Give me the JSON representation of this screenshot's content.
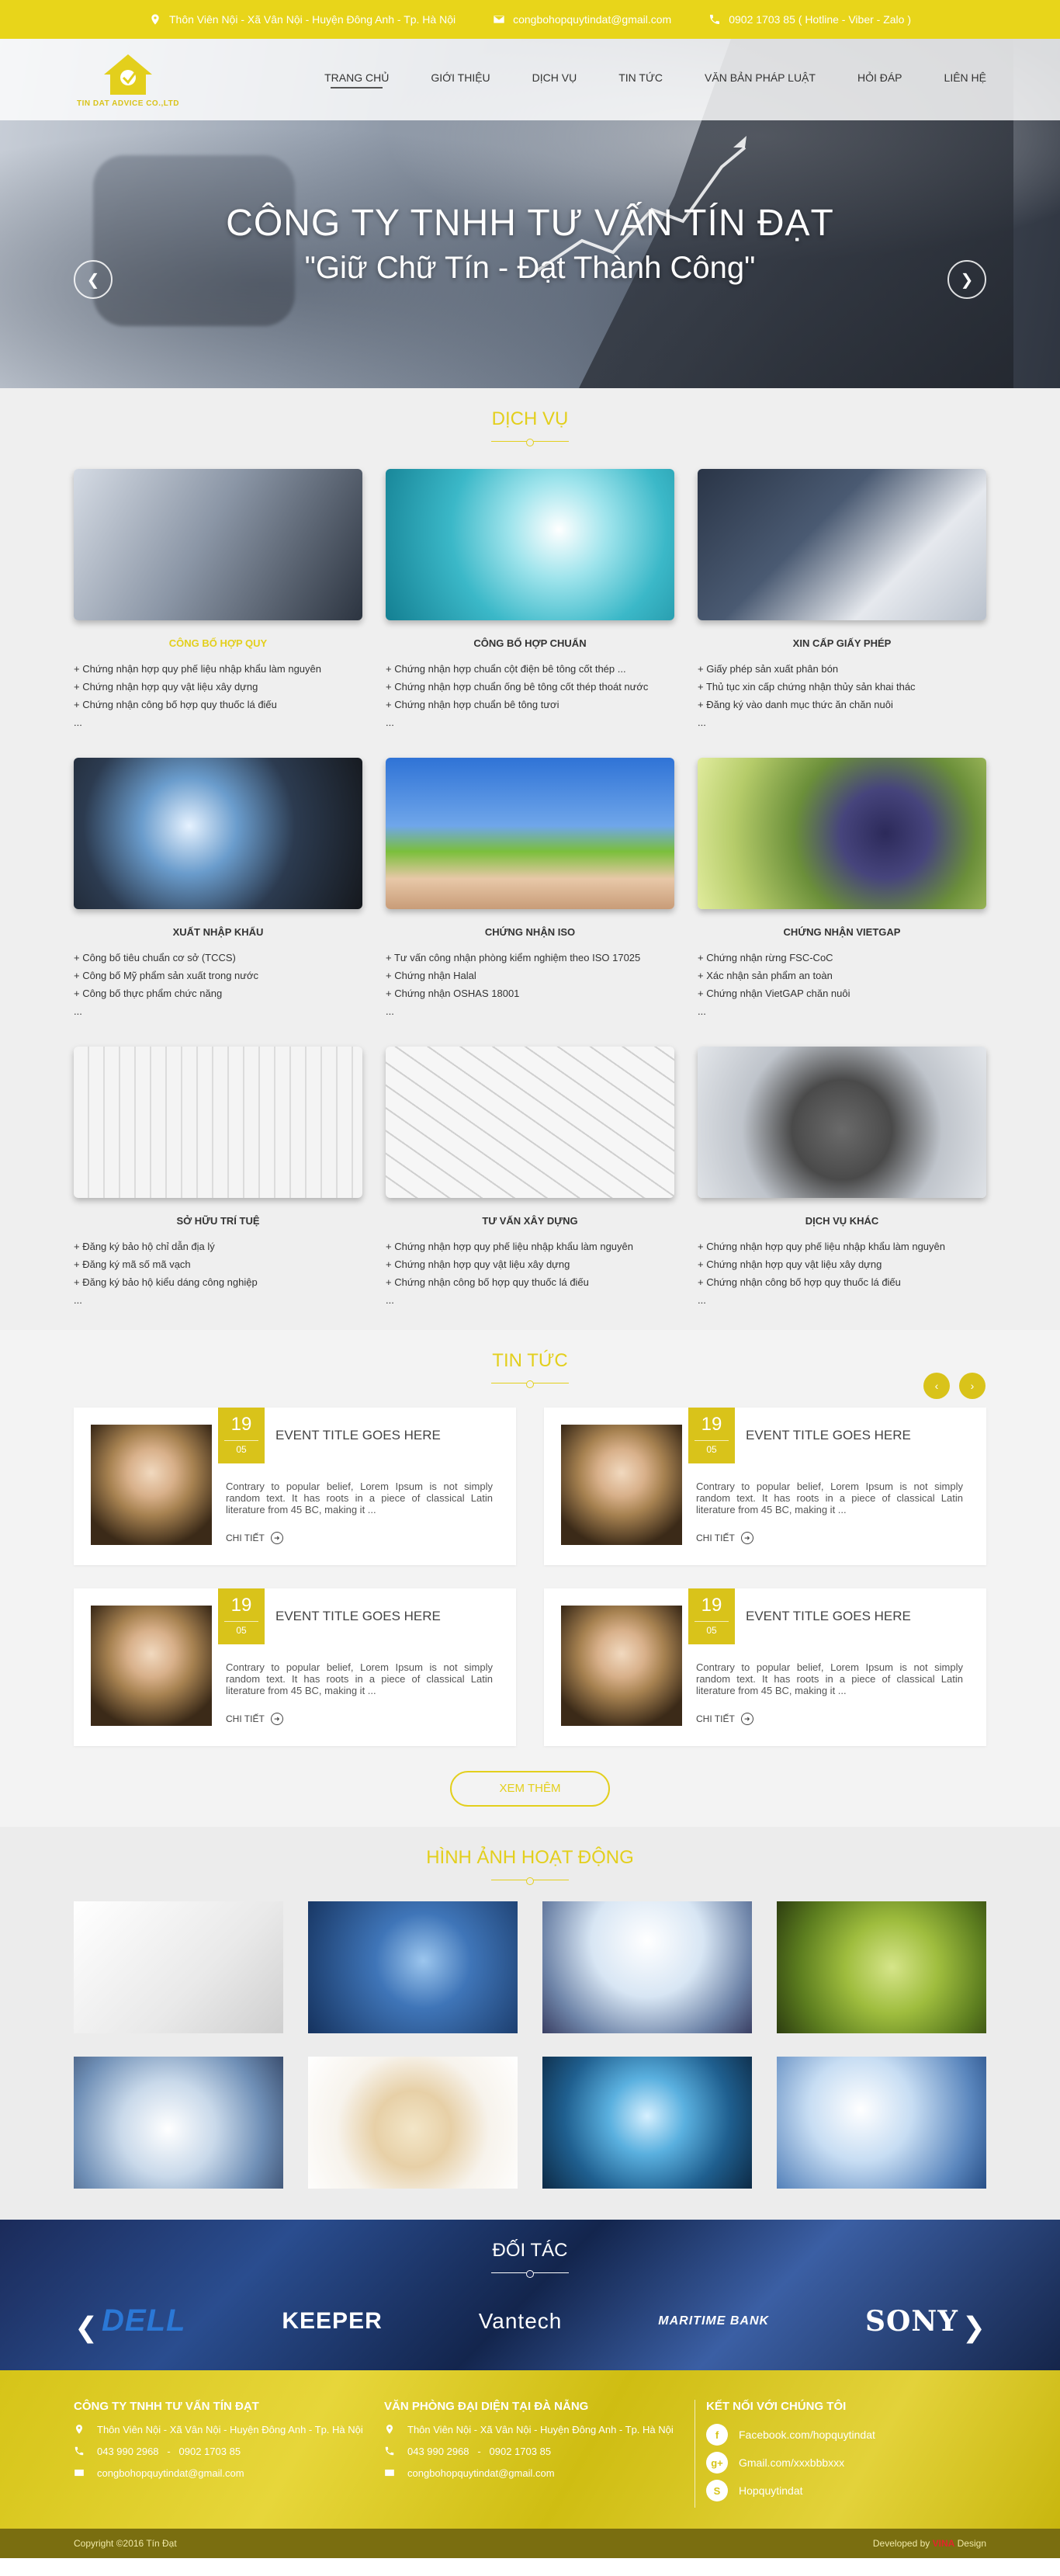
{
  "topbar": {
    "address": "Thôn Viên Nội - Xã Vân Nội - Huyện Đông Anh - Tp. Hà Nội",
    "email": "congbohopquytindat@gmail.com",
    "phone": "0902 1703 85 ( Hotline - Viber - Zalo )"
  },
  "logo": {
    "text": "TIN DAT ADVICE CO.,LTD"
  },
  "nav": [
    {
      "label": "TRANG CHỦ"
    },
    {
      "label": "GIỚI THIỆU"
    },
    {
      "label": "DỊCH VỤ"
    },
    {
      "label": "TIN TỨC"
    },
    {
      "label": "VĂN BẢN PHÁP LUẬT"
    },
    {
      "label": "HỎI ĐÁP"
    },
    {
      "label": "LIÊN HỆ"
    }
  ],
  "hero": {
    "title": "CÔNG TY TNHH TƯ VẤN TÍN ĐẠT",
    "slogan": "\"Giữ Chữ Tín - Đạt Thành Công\""
  },
  "services": {
    "title": "DỊCH VỤ",
    "items": [
      {
        "name": "CÔNG BỐ HỢP QUY",
        "lines": [
          "+ Chứng nhận hợp quy phế liệu nhập khẩu làm nguyên",
          "+ Chứng nhận hợp quy vật liệu xây dựng",
          "+ Chứng nhận công bố hợp quy thuốc lá điếu",
          "..."
        ]
      },
      {
        "name": "CÔNG BỐ HỢP CHUẨN",
        "lines": [
          "+ Chứng nhận hợp chuẩn cột điện bê tông cốt thép ...",
          "+ Chứng nhận hợp chuẩn ống bê tông cốt thép thoát nước",
          "+ Chứng nhận hợp chuẩn bê tông tươi",
          "..."
        ]
      },
      {
        "name": "XIN CẤP GIẤY PHÉP",
        "lines": [
          "+ Giấy phép sản xuất phân bón",
          "+ Thủ tục xin cấp chứng nhận thủy sản khai thác",
          "+ Đăng ký vào danh mục thức ăn chăn nuôi",
          "..."
        ]
      },
      {
        "name": "XUẤT NHẬP KHẨU",
        "lines": [
          "+ Công bố tiêu chuẩn cơ sở (TCCS)",
          "+ Công bố Mỹ phẩm sản xuất trong nước",
          "+ Công bố thực phẩm chức năng",
          "..."
        ]
      },
      {
        "name": "CHỨNG NHẬN ISO",
        "lines": [
          "+ Tư vấn công nhận phòng kiểm nghiệm theo ISO 17025",
          "+ Chứng nhận Halal",
          "+ Chứng nhận OSHAS 18001",
          "..."
        ]
      },
      {
        "name": "CHỨNG NHẬN VIETGAP",
        "lines": [
          "+ Chứng nhận rừng FSC-CoC",
          "+ Xác nhận sản phẩm an toàn",
          "+ Chứng nhận VietGAP chăn nuôi",
          "..."
        ]
      },
      {
        "name": "SỞ HỮU TRÍ TUỆ",
        "lines": [
          "+ Đăng ký bảo hộ chỉ dẫn địa lý",
          "+ Đăng ký mã số mã vạch",
          "+ Đăng ký bảo hộ kiểu dáng công nghiệp",
          "..."
        ]
      },
      {
        "name": "TƯ VẤN XÂY DỰNG",
        "lines": [
          "+ Chứng nhận hợp quy phế liệu nhập khẩu làm nguyên",
          "+ Chứng nhận hợp quy vật liệu xây dựng",
          "+ Chứng nhận công bố hợp quy thuốc lá điếu",
          "..."
        ]
      },
      {
        "name": "DỊCH VỤ KHÁC",
        "lines": [
          "+ Chứng nhận hợp quy phế liệu nhập khẩu làm nguyên",
          "+ Chứng nhận hợp quy vật liệu xây dựng",
          "+ Chứng nhận công bố hợp quy thuốc lá điếu",
          "..."
        ]
      }
    ]
  },
  "news": {
    "title": "TIN TỨC",
    "nav_prev": "‹",
    "nav_next": "›",
    "items": [
      {
        "day": "19",
        "month": "05",
        "title": "EVENT TITLE GOES HERE",
        "desc": "Contrary to popular belief, Lorem Ipsum is not simply random text. It has roots in a piece of classical Latin literature from 45 BC, making it ...",
        "more": "CHI TIẾT"
      },
      {
        "day": "19",
        "month": "05",
        "title": "EVENT TITLE GOES HERE",
        "desc": "Contrary to popular belief, Lorem Ipsum is not simply random text. It has roots in a piece of classical Latin literature from 45 BC, making it ...",
        "more": "CHI TIẾT"
      },
      {
        "day": "19",
        "month": "05",
        "title": "EVENT TITLE GOES HERE",
        "desc": "Contrary to popular belief, Lorem Ipsum is not simply random text. It has roots in a piece of classical Latin literature from 45 BC, making it ...",
        "more": "CHI TIẾT"
      },
      {
        "day": "19",
        "month": "05",
        "title": "EVENT TITLE GOES HERE",
        "desc": "Contrary to popular belief, Lorem Ipsum is not simply random text. It has roots in a piece of classical Latin literature from 45 BC, making it ...",
        "more": "CHI TIẾT"
      }
    ],
    "view_more": "XEM THÊM"
  },
  "gallery": {
    "title": "HÌNH ẢNH HOẠT ĐỘNG"
  },
  "partners": {
    "title": "ĐỐI TÁC",
    "logos": [
      "DELL",
      "KEEPER",
      "Vantech",
      "MARITIME BANK",
      "SONY"
    ]
  },
  "footer": {
    "col1": {
      "title": "CÔNG TY TNHH TƯ VẤN TÍN ĐẠT",
      "address": "Thôn Viên Nội - Xã Vân Nội - Huyện Đông Anh - Tp. Hà Nội",
      "phone": "043 990 2968   -   0902 1703 85",
      "email": "congbohopquytindat@gmail.com"
    },
    "col2": {
      "title": "VĂN PHÒNG ĐẠI DIỆN TẠI ĐÀ NẴNG",
      "address": "Thôn Viên Nội - Xã Vân Nội - Huyện Đông Anh - Tp. Hà Nội",
      "phone": "043 990 2968   -   0902 1703 85",
      "email": "congbohopquytindat@gmail.com"
    },
    "col3": {
      "title": "KẾT NỐI VỚI CHÚNG TÔI",
      "facebook": "Facebook.com/hopquytindat",
      "gmail": "Gmail.com/xxxbbbxxx",
      "skype": "Hopquytindat"
    },
    "copyright": "Copyright ©2016 Tín Đạt",
    "developed_by": "Developed by",
    "developer": "VINA",
    "developer_suffix": "Design"
  }
}
